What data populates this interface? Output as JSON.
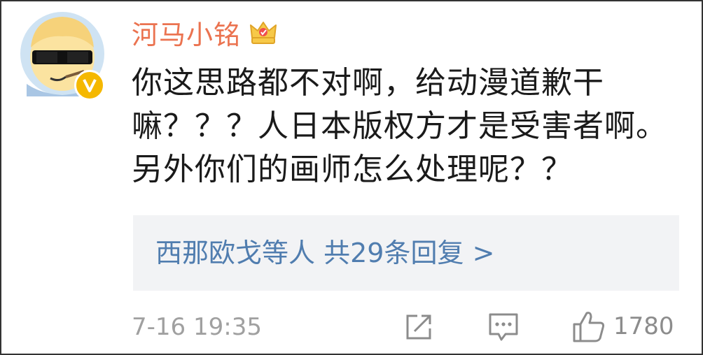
{
  "comment": {
    "username": "河马小铭",
    "text": "你这思路都不对啊，给动漫道歉干嘛？？？人日本版权方才是受害者啊。另外你们的画师怎么处理呢？？",
    "replies": {
      "names": "西那欧戈等人",
      "count_text": "共29条回复",
      "arrow": ">"
    },
    "timestamp": "7-16 19:35",
    "like_count": "1780"
  },
  "colors": {
    "username": "#eb7350",
    "link": "#507daf",
    "reply_bg": "#f2f3f5",
    "meta": "#a0a0a0",
    "verified_badge": "#f5b800"
  },
  "icons": {
    "avatar": "cartoon-avatar-with-sunglasses",
    "vip": "crown-icon",
    "verified": "verified-v-icon",
    "share": "share-icon",
    "comment": "comment-icon",
    "like": "thumbs-up-icon"
  }
}
